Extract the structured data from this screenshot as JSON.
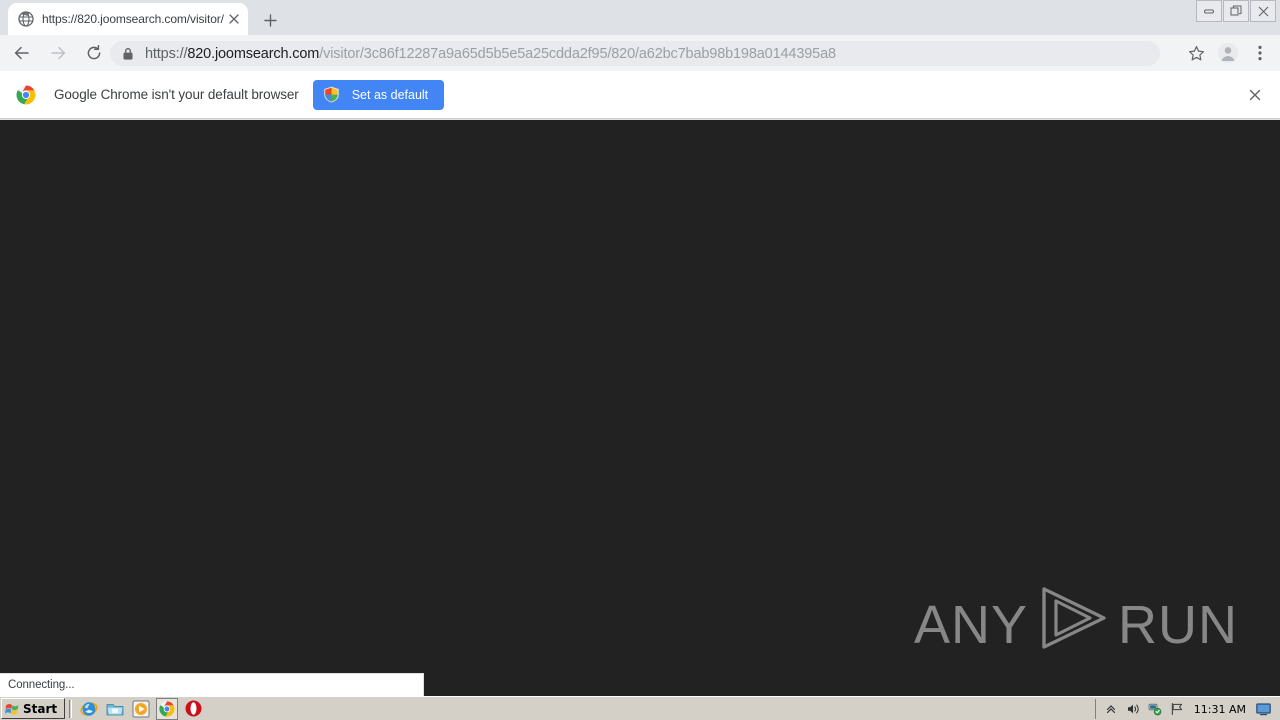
{
  "window": {
    "controls": [
      {
        "name": "minimize",
        "glyph": "minimize-icon"
      },
      {
        "name": "restore",
        "glyph": "restore-icon"
      },
      {
        "name": "close",
        "glyph": "close-icon"
      }
    ]
  },
  "tabstrip": {
    "tab": {
      "favicon": "globe-icon",
      "title": "https://820.joomsearch.com/visitor/",
      "close_label": "×"
    },
    "new_tab_label": "+"
  },
  "toolbar": {
    "back_icon": "back-arrow-icon",
    "forward_icon": "forward-arrow-icon",
    "reload_icon": "reload-icon",
    "security_icon": "lock-icon",
    "url": {
      "scheme": "https://",
      "host": "820.joomsearch.com",
      "path": "/visitor/3c86f12287a9a65d5b5e5a25cdda2f95/820/a62bc7bab98b198a0144395a8",
      "full": "https://820.joomsearch.com/visitor/3c86f12287a9a65d5b5e5a25cdda2f95/820/a62bc7bab98b198a0144395a8"
    },
    "bookmark_icon": "star-icon",
    "profile_icon": "avatar-icon",
    "menu_icon": "three-dot-menu-icon"
  },
  "infobar": {
    "brand_icon": "chrome-logo-icon",
    "message": "Google Chrome isn't your default browser",
    "button_label": "Set as default",
    "button_icon": "shield-icon",
    "button_color": "#4285f4",
    "close_label": "×"
  },
  "page": {
    "background_color": "#222222",
    "watermark": {
      "left_text": "ANY",
      "right_text": "RUN",
      "logo_icon": "anyrun-play-logo-icon",
      "color": "#8d8d8d"
    }
  },
  "status": {
    "text": "Connecting..."
  },
  "taskbar": {
    "start_label": "Start",
    "start_icon": "windows-flag-icon",
    "quick_launch": [
      {
        "name": "internet-explorer-icon",
        "active": false
      },
      {
        "name": "show-desktop-folder-icon",
        "active": false
      },
      {
        "name": "media-player-icon",
        "active": false
      },
      {
        "name": "chrome-icon",
        "active": true
      },
      {
        "name": "opera-icon",
        "active": false
      }
    ],
    "tray": {
      "icons": [
        "show-hidden-icons-icon",
        "volume-icon",
        "network-icon",
        "flag-action-center-icon"
      ],
      "time": "11:31 AM",
      "desktop_icon": "show-desktop-icon"
    }
  }
}
